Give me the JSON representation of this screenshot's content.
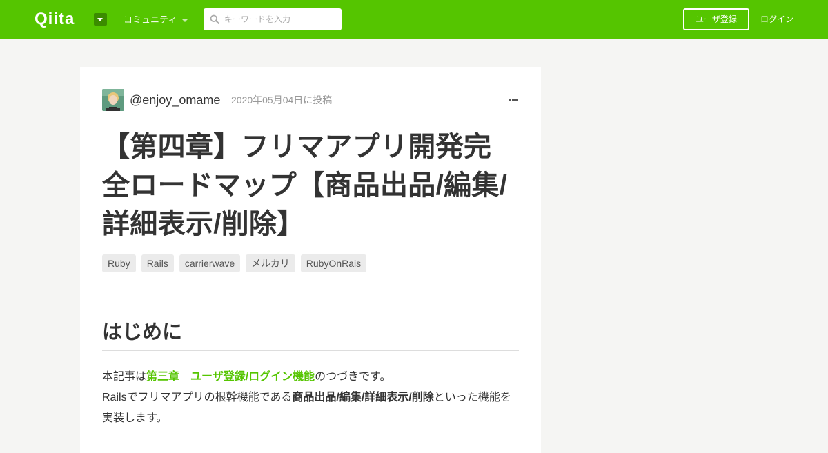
{
  "header": {
    "logo": "Qiita",
    "community_label": "コミュニティ",
    "search_placeholder": "キーワードを入力",
    "signup_label": "ユーザ登録",
    "login_label": "ログイン"
  },
  "colors": {
    "brand": "#55c500",
    "brand_dark": "#3b8c00",
    "page_bg": "#f5f5f3"
  },
  "article": {
    "author": "@enjoy_omame",
    "posted_date": "2020年05月04日に投稿",
    "title": "【第四章】フリマアプリ開発完全ロードマップ【商品出品/編集/詳細表示/削除】",
    "tags": [
      "Ruby",
      "Rails",
      "carrierwave",
      "メルカリ",
      "RubyOnRais"
    ],
    "section_heading": "はじめに",
    "paragraph1": {
      "prefix": "本記事は",
      "link": "第三章　ユーザ登録/ログイン機能",
      "suffix": "のつづきです。"
    },
    "paragraph2": {
      "prefix": "Railsでフリマアプリの根幹機能である",
      "bold": "商品出品/編集/詳細表示/削除",
      "suffix": "といった機能を実装します。"
    }
  },
  "icons": {
    "search": "search-icon",
    "dropdown": "chevron-down-icon",
    "more": "more-icon",
    "avatar": "avatar"
  }
}
